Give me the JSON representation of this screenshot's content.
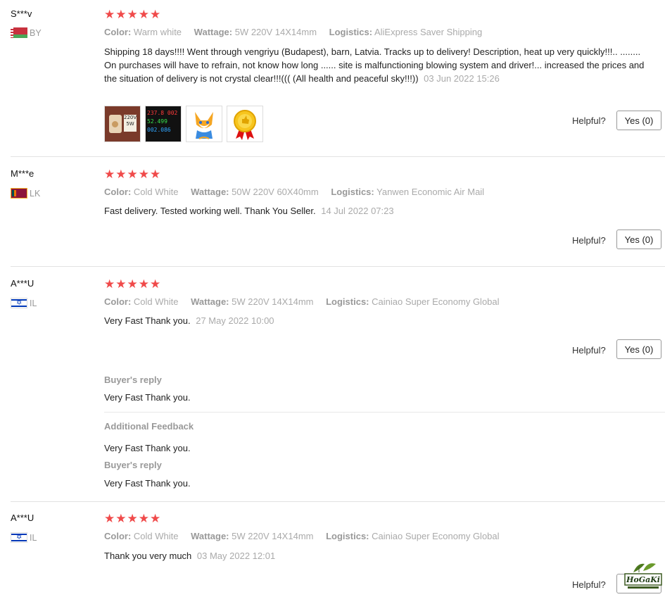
{
  "reviews": [
    {
      "user": "S***v",
      "country": "BY",
      "stars": "★★★★★",
      "color_label": "Color:",
      "color_value": "Warm white",
      "wattage_label": "Wattage:",
      "wattage_value": "5W 220V 14X14mm",
      "logistics_label": "Logistics:",
      "logistics_value": "AliExpress Saver Shipping",
      "text": "Shipping 18 days!!!! Went through vengriyu (Budapest), barn, Latvia. Tracks up to delivery! Description, heat up very quickly!!!.. ........ On purchases will have to refrain, not know how long ...... site is malfunctioning blowing system and driver!... increased the prices and the situation of delivery is not crystal clear!!!((( (All health and peaceful sky!!!))",
      "date": "03 Jun 2022 15:26",
      "helpful_label": "Helpful?",
      "yes_label": "Yes (0)",
      "photos": {
        "p1_line1": "220V",
        "p1_line2": "5W",
        "p2_line1": "237.8 002",
        "p2_line2": "52.499",
        "p2_line3": "002.086"
      }
    },
    {
      "user": "M***e",
      "country": "LK",
      "stars": "★★★★★",
      "color_label": "Color:",
      "color_value": "Cold White",
      "wattage_label": "Wattage:",
      "wattage_value": "50W 220V 60X40mm",
      "logistics_label": "Logistics:",
      "logistics_value": "Yanwen Economic Air Mail",
      "text": "Fast delivery. Tested working well. Thank You Seller.",
      "date": "14 Jul 2022 07:23",
      "helpful_label": "Helpful?",
      "yes_label": "Yes (0)"
    },
    {
      "user": "A***U",
      "country": "IL",
      "stars": "★★★★★",
      "color_label": "Color:",
      "color_value": "Cold White",
      "wattage_label": "Wattage:",
      "wattage_value": "5W 220V 14X14mm",
      "logistics_label": "Logistics:",
      "logistics_value": "Cainiao Super Economy Global",
      "text": "Very Fast Thank you.",
      "date": "27 May 2022 10:00",
      "helpful_label": "Helpful?",
      "yes_label": "Yes (0)",
      "reply_label": "Buyer's reply",
      "reply_text": "Very Fast Thank you.",
      "additional_label": "Additional Feedback",
      "additional_text": "Very Fast Thank you.",
      "reply2_label": "Buyer's reply",
      "reply2_text": "Very Fast Thank you."
    },
    {
      "user": "A***U",
      "country": "IL",
      "stars": "★★★★★",
      "color_label": "Color:",
      "color_value": "Cold White",
      "wattage_label": "Wattage:",
      "wattage_value": "5W 220V 14X14mm",
      "logistics_label": "Logistics:",
      "logistics_value": "Cainiao Super Economy Global",
      "text": "Thank you very much",
      "date": "03 May 2022 12:01",
      "helpful_label": "Helpful?"
    }
  ],
  "watermark": {
    "brand": "HoGaKi"
  },
  "colors": {
    "star": "#f04a4a",
    "meta": "#aaaaaa",
    "divider": "#e2e2e2"
  }
}
